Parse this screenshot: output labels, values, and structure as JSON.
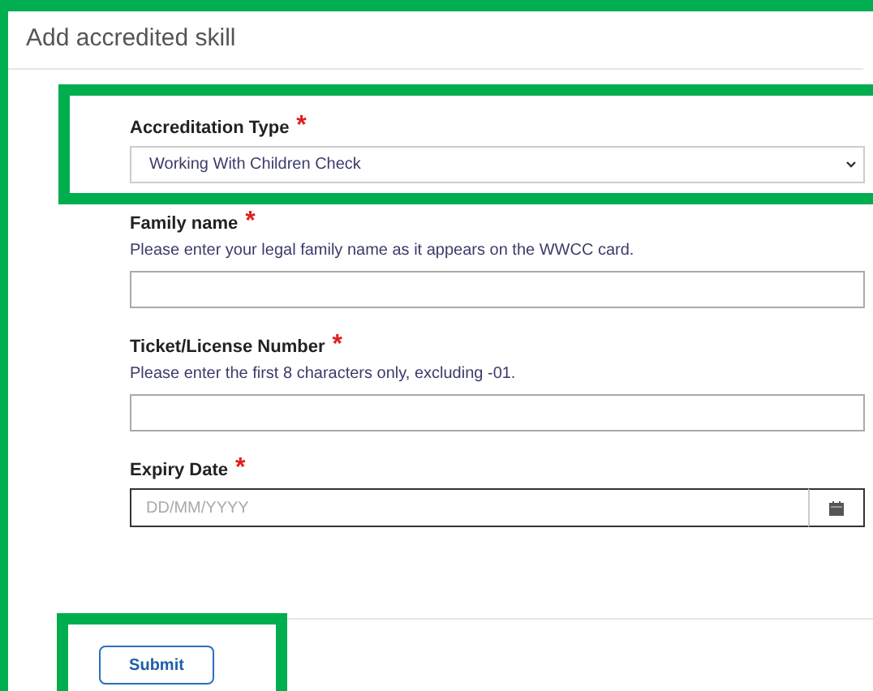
{
  "title": "Add accredited skill",
  "fields": [
    {
      "kind": "select",
      "label": "Accreditation Type",
      "required": true,
      "value": "Working With Children Check",
      "highlighted": true
    },
    {
      "kind": "text",
      "label": "Family name",
      "required": true,
      "hint": "Please enter your legal family name as it appears on the WWCC card.",
      "highlighted": false
    },
    {
      "kind": "text",
      "label": "Ticket/License Number",
      "required": true,
      "hint": "Please enter the first 8 characters only, excluding -01.",
      "highlighted": false
    },
    {
      "kind": "date",
      "label": "Expiry Date",
      "required": true,
      "placeholder": "DD/MM/YYYY",
      "focused": true,
      "highlighted": false
    }
  ],
  "submit": {
    "label": "Submit",
    "highlighted": true
  },
  "required_mark": "*"
}
